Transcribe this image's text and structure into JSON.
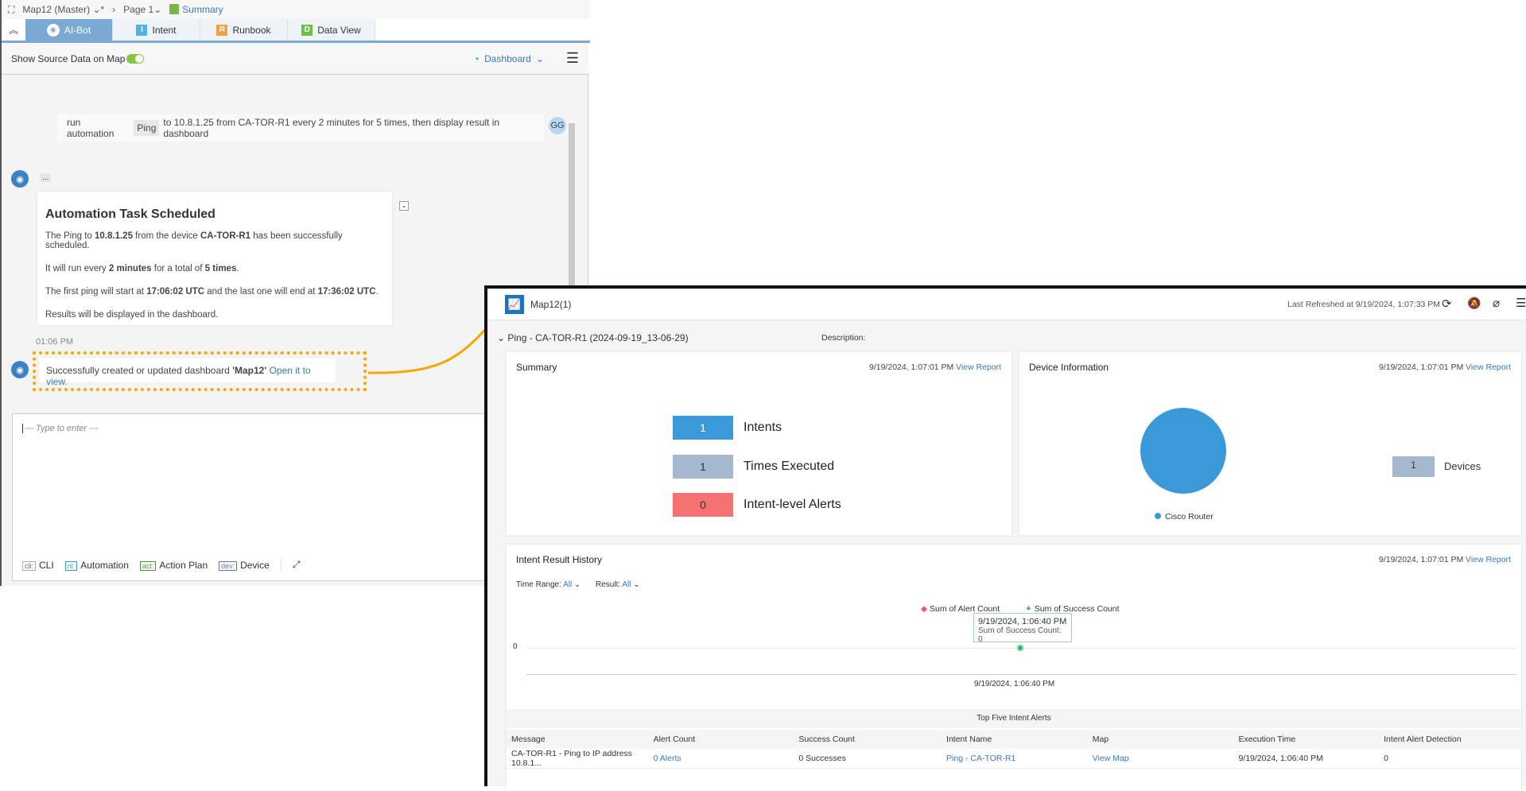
{
  "breadcrumb": {
    "map": "Map12 (Master)",
    "modified": "*",
    "page": "Page 1",
    "summary": "Summary"
  },
  "tabs": [
    {
      "label": "AI-Bot",
      "badge": ""
    },
    {
      "label": "Intent",
      "badge": "I",
      "color": "#4fb3e8"
    },
    {
      "label": "Runbook",
      "badge": "R",
      "color": "#f0a04b"
    },
    {
      "label": "Data View",
      "badge": "D",
      "color": "#6bbf4a"
    }
  ],
  "toolbar": {
    "show_source": "Show Source Data on Map",
    "show_source_on": true,
    "dashboard": "Dashboard"
  },
  "chat": {
    "user_msg": {
      "pre": "run automation",
      "chip": "Ping",
      "post": "to 10.8.1.25  from CA-TOR-R1 every 2 minutes for 5 times, then display result in dashboard",
      "avatar": "GG"
    },
    "typing": "...",
    "card": {
      "title": "Automation Task Scheduled",
      "l1": [
        "The Ping to ",
        "10.8.1.25",
        " from the device ",
        "CA-TOR-R1",
        " has been successfully scheduled."
      ],
      "l2": [
        "It will run every ",
        "2 minutes",
        " for a total of ",
        "5 times",
        "."
      ],
      "l3": [
        "The first ping will start at ",
        "17:06:02 UTC",
        " and the last one will end at ",
        "17:36:02 UTC",
        "."
      ],
      "l4": "Results will be displayed in the dashboard."
    },
    "time": "01:06 PM",
    "result": {
      "pre": "Successfully created or updated dashboard ",
      "name": "'Map12'",
      ".": ".",
      "link": "Open it to view."
    }
  },
  "input": {
    "placeholder": "--- Type to enter ---",
    "buttons": [
      {
        "tag": "cli:",
        "label": "CLI"
      },
      {
        "tag": "ni:",
        "label": "Automation"
      },
      {
        "tag": "act:",
        "label": "Action Plan"
      },
      {
        "tag": "dev:",
        "label": "Device"
      }
    ]
  },
  "dashboard": {
    "title": "Map12(1)",
    "last_refreshed": "Last Refreshed at 9/19/2024, 1:07:33 PM",
    "section": "Ping - CA-TOR-R1 (2024-09-19_13-06-29)",
    "description": "Description:",
    "summary": {
      "title": "Summary",
      "date": "9/19/2024, 1:07:01 PM",
      "view": "View Report",
      "stats": [
        {
          "value": "1",
          "label": "Intents",
          "color": "#3a9ad9"
        },
        {
          "value": "1",
          "label": "Times Executed",
          "color": "#a6b8d0"
        },
        {
          "value": "0",
          "label": "Intent-level Alerts",
          "color": "#f47272"
        }
      ]
    },
    "device": {
      "title": "Device Information",
      "date": "9/19/2024, 1:07:01 PM",
      "view": "View Report",
      "legend": "Cisco Router",
      "pie_color": "#3a9ad9",
      "count": "1",
      "count_label": "Devices"
    },
    "history": {
      "title": "Intent Result History",
      "date": "9/19/2024, 1:07:01 PM",
      "view": "View Report",
      "time_range_label": "Time Range:",
      "time_range": "All",
      "result_label": "Result:",
      "result": "All",
      "tooltip_time": "9/19/2024, 1:06:40 PM",
      "tooltip_value": "Sum of Success Count: 0"
    },
    "table": {
      "title": "Top Five Intent Alerts",
      "columns": [
        "Message",
        "Alert Count",
        "Success Count",
        "Intent Name",
        "Map",
        "Execution Time",
        "Intent Alert Detection"
      ],
      "rows": [
        [
          "CA-TOR-R1 - Ping to IP address 10.8.1...",
          "0 Alerts",
          "0 Successes",
          "Ping - CA-TOR-R1",
          "View Map",
          "9/19/2024, 1:06:40 PM",
          "0"
        ]
      ]
    }
  },
  "chart_data": {
    "type": "line",
    "x": [
      "9/19/2024, 1:06:40 PM"
    ],
    "yticks": [
      "0"
    ],
    "series": [
      {
        "name": "Sum of Alert Count",
        "values": [
          0
        ],
        "color": "#f05a5a"
      },
      {
        "name": "Sum of Success Count",
        "values": [
          0
        ],
        "color": "#3bb07a"
      }
    ],
    "legend": "top-center"
  }
}
